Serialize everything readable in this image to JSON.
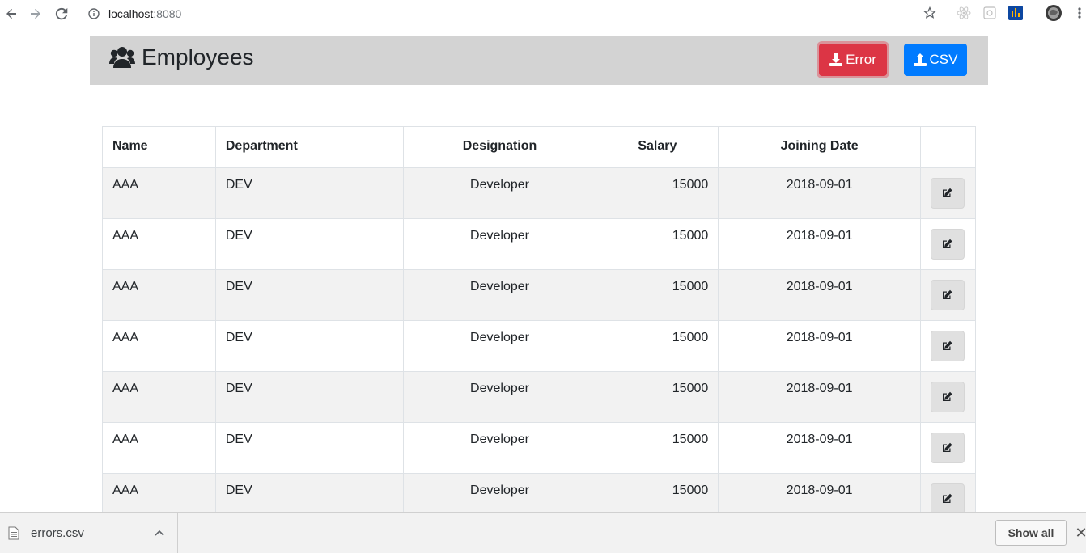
{
  "browser": {
    "url_host": "localhost",
    "url_port": ":8080",
    "icons": [
      "back-icon",
      "forward-icon",
      "reload-icon",
      "site-info-icon",
      "bookmark-star-icon",
      "react-devtools-icon",
      "extension-icon",
      "analytics-extension-icon",
      "profile-avatar-icon",
      "menu-kebab-icon"
    ]
  },
  "header": {
    "title": "Employees",
    "error_button": "Error",
    "csv_button": "CSV",
    "colors": {
      "header_bg": "#d3d3d3",
      "error": "#dc3545",
      "csv": "#007bff"
    }
  },
  "table": {
    "columns": [
      "Name",
      "Department",
      "Designation",
      "Salary",
      "Joining Date",
      ""
    ],
    "rows": [
      {
        "name": "AAA",
        "department": "DEV",
        "designation": "Developer",
        "salary": "15000",
        "joining_date": "2018-09-01"
      },
      {
        "name": "AAA",
        "department": "DEV",
        "designation": "Developer",
        "salary": "15000",
        "joining_date": "2018-09-01"
      },
      {
        "name": "AAA",
        "department": "DEV",
        "designation": "Developer",
        "salary": "15000",
        "joining_date": "2018-09-01"
      },
      {
        "name": "AAA",
        "department": "DEV",
        "designation": "Developer",
        "salary": "15000",
        "joining_date": "2018-09-01"
      },
      {
        "name": "AAA",
        "department": "DEV",
        "designation": "Developer",
        "salary": "15000",
        "joining_date": "2018-09-01"
      },
      {
        "name": "AAA",
        "department": "DEV",
        "designation": "Developer",
        "salary": "15000",
        "joining_date": "2018-09-01"
      },
      {
        "name": "AAA",
        "department": "DEV",
        "designation": "Developer",
        "salary": "15000",
        "joining_date": "2018-09-01"
      }
    ]
  },
  "download_shelf": {
    "file_name": "errors.csv",
    "show_all": "Show all",
    "close": "✕"
  }
}
